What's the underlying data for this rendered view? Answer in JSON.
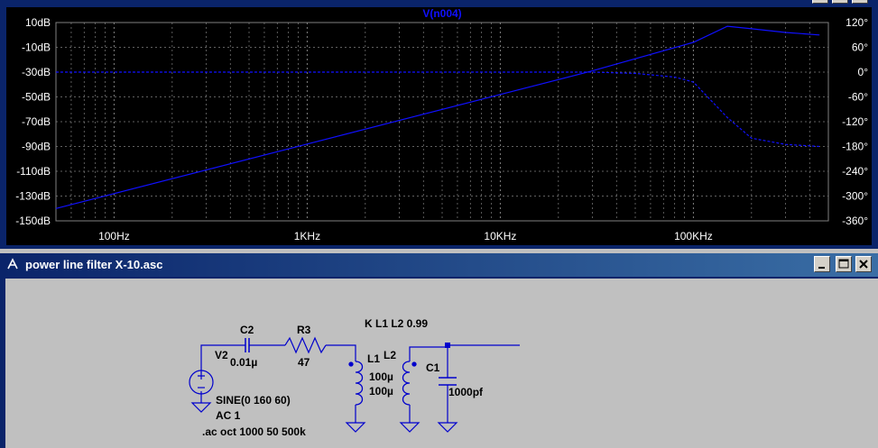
{
  "plot": {
    "trace_title": "V(n004)",
    "y_left_ticks": [
      "10dB",
      "-10dB",
      "-30dB",
      "-50dB",
      "-70dB",
      "-90dB",
      "-110dB",
      "-130dB",
      "-150dB"
    ],
    "y_right_ticks": [
      "120°",
      "60°",
      "0°",
      "-60°",
      "-120°",
      "-180°",
      "-240°",
      "-300°",
      "-360°"
    ],
    "x_ticks": [
      "100Hz",
      "1KHz",
      "10KHz",
      "100KHz"
    ],
    "colors": {
      "background": "#000000",
      "trace": "#1010ff",
      "grid": "#808080",
      "frame": "#0a246a"
    }
  },
  "chart_data": {
    "type": "line",
    "title": "V(n004)",
    "x_scale": "log",
    "xlim": [
      50,
      500000
    ],
    "ylim": [
      -150,
      10
    ],
    "y2lim": [
      -360,
      120
    ],
    "grid": true,
    "series": [
      {
        "axis": "magnitude",
        "x": [
          50,
          100,
          1000,
          10000,
          30000,
          100000,
          150000,
          200000,
          300000,
          450000
        ],
        "y": [
          -140,
          -128,
          -88,
          -48,
          -29,
          -6,
          7,
          5,
          2,
          0
        ]
      },
      {
        "axis": "phase",
        "x": [
          50,
          1000,
          10000,
          30000,
          50000,
          80000,
          100000,
          150000,
          200000,
          300000,
          450000
        ],
        "y": [
          0,
          0,
          0,
          0,
          -3,
          -12,
          -24,
          -110,
          -160,
          -175,
          -180
        ]
      }
    ]
  },
  "schematic": {
    "window_title": "power line filter X-10.asc",
    "labels": {
      "coupling": "K L1 L2 0.99",
      "c2": "C2",
      "c2_value": "0.01µ",
      "r3": "R3",
      "r3_value": "47",
      "v2": "V2",
      "l1": "L1",
      "l1_value": "100µ",
      "l2": "L2",
      "l2_value": "100µ",
      "c1": "C1",
      "c1_value": "1000pf",
      "source_sine": "SINE(0 160 60)",
      "source_ac": "AC 1",
      "directive": ".ac oct 1000 50 500k"
    },
    "colors": {
      "wire": "#0000cc",
      "canvas": "#c0c0c0",
      "titlebar": "#0a246a"
    }
  }
}
